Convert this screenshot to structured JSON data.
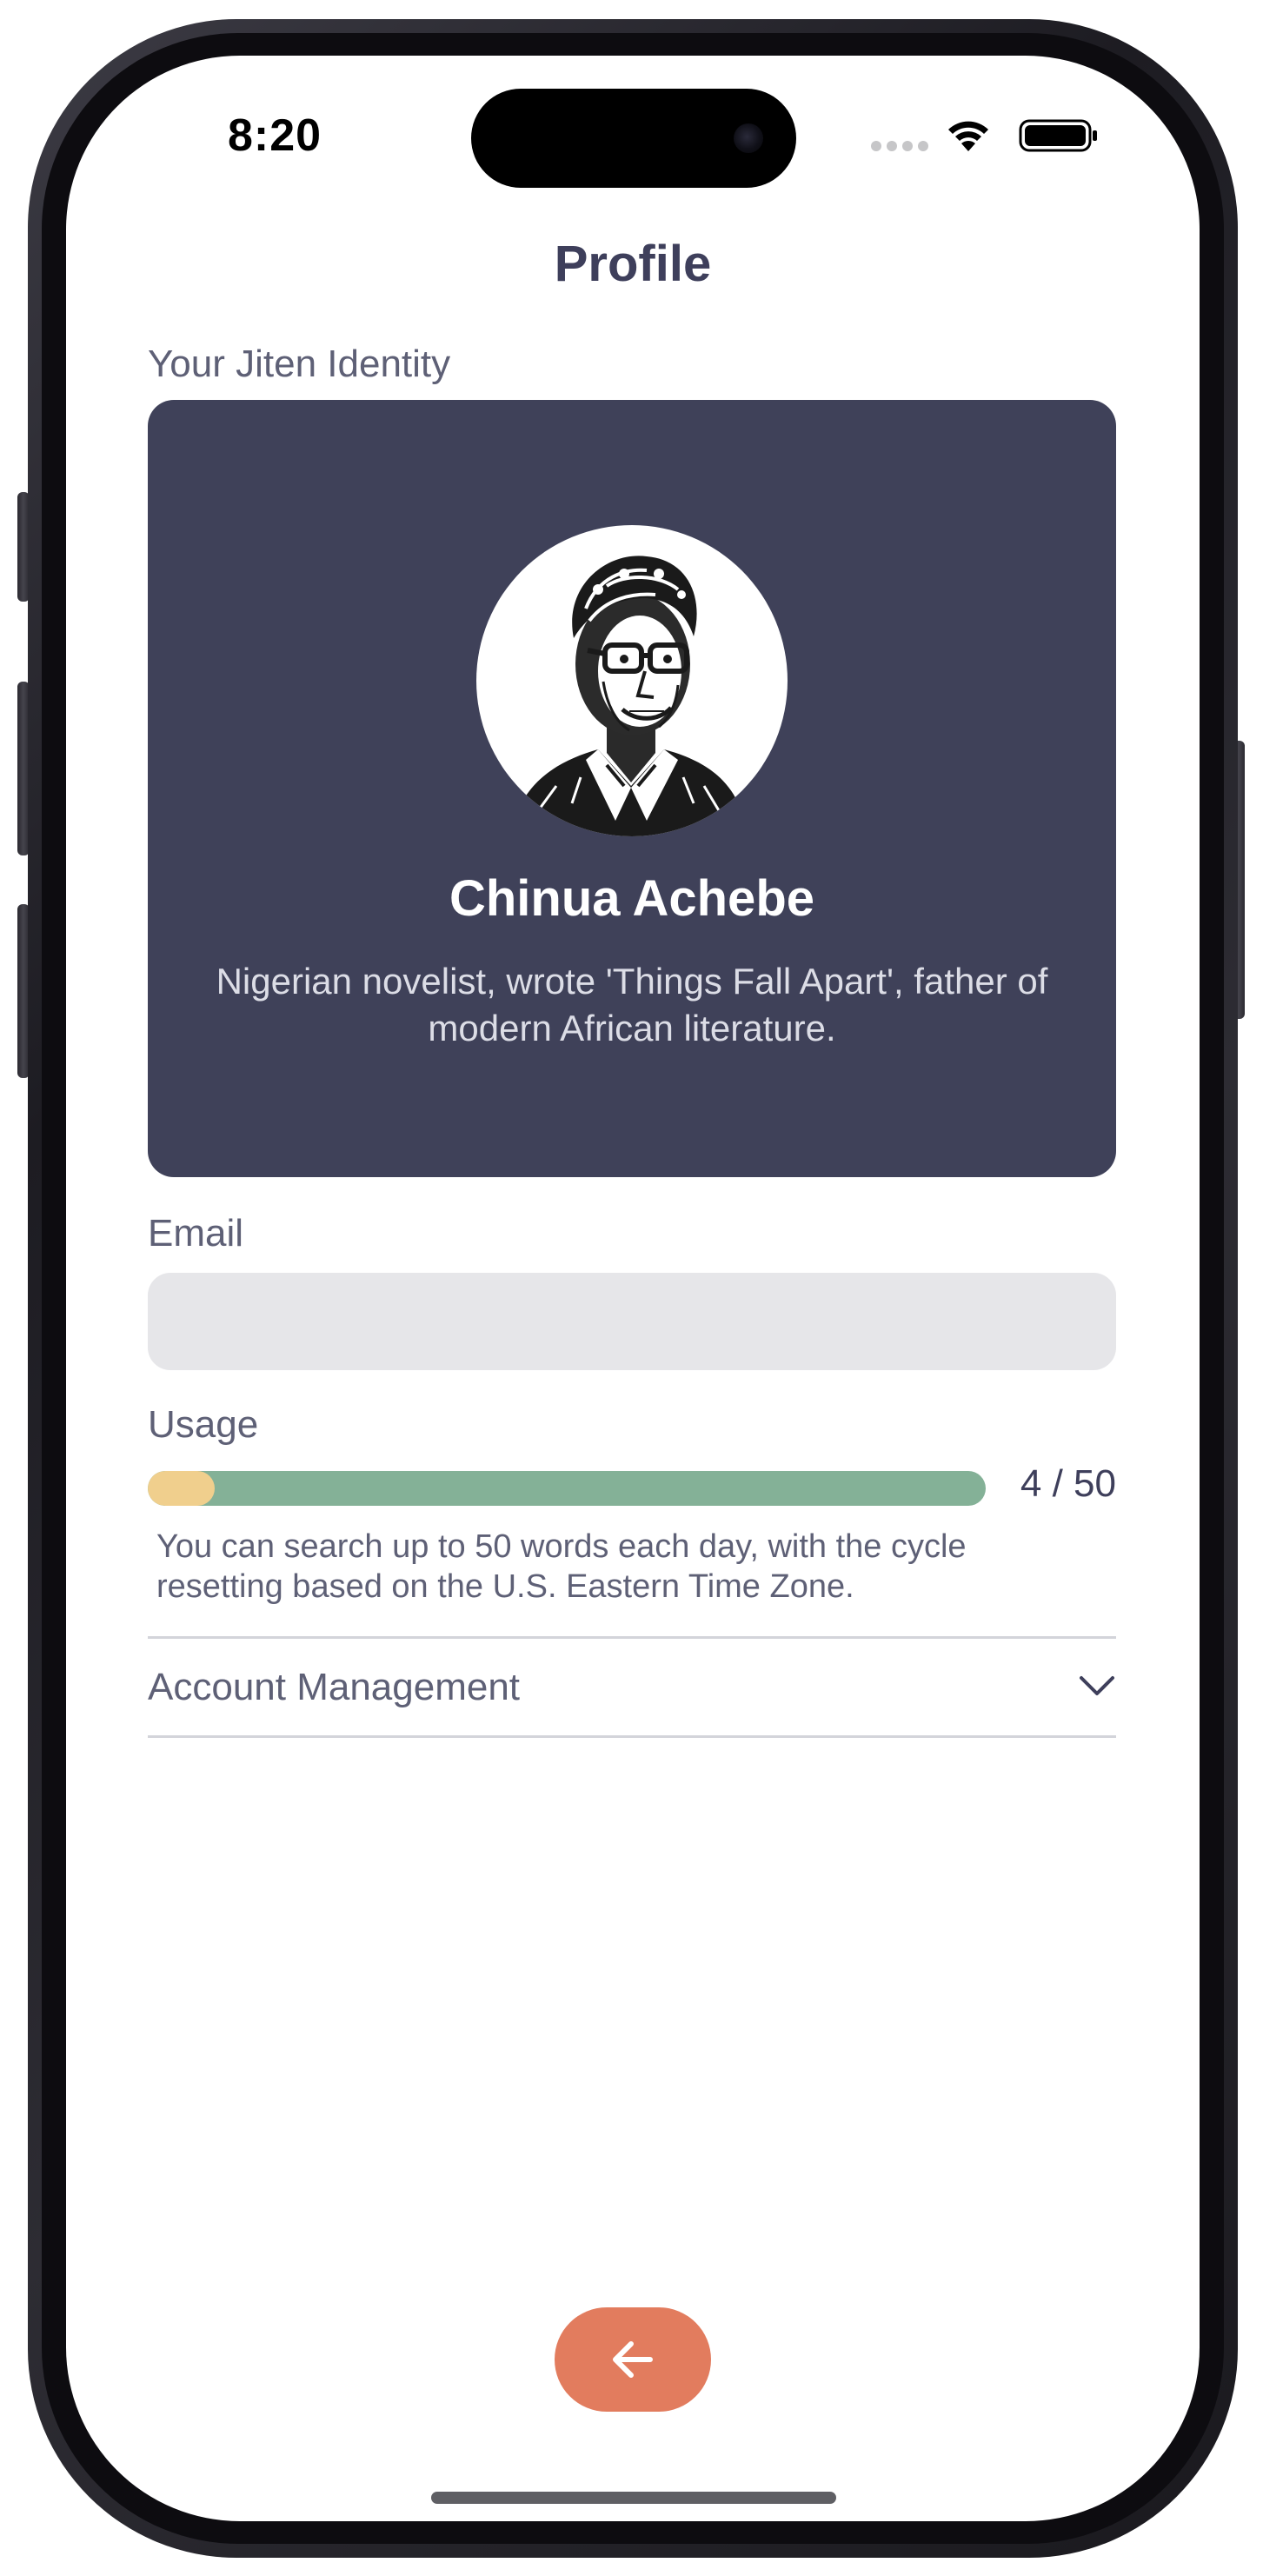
{
  "status_bar": {
    "time": "8:20"
  },
  "header": {
    "title": "Profile"
  },
  "identity": {
    "section_label": "Your Jiten Identity",
    "name": "Chinua Achebe",
    "description": "Nigerian novelist, wrote 'Things Fall Apart', father of modern African literature.",
    "avatar_icon": "portrait-illustration"
  },
  "email": {
    "label": "Email",
    "value": ""
  },
  "usage": {
    "label": "Usage",
    "used": 4,
    "limit": 50,
    "count_text": "4 / 50",
    "note": "You can search up to 50 words each day, with the cycle resetting based on the U.S. Eastern Time Zone."
  },
  "account": {
    "label": "Account Management",
    "icon": "chevron-down-icon"
  },
  "back_button": {
    "icon": "arrow-left-icon"
  },
  "colors": {
    "title": "#3e3f5b",
    "card_background": "#3f4159",
    "usage_track": "#84b197",
    "usage_fill": "#f0cf8d",
    "back_button": "#e27c5e"
  }
}
